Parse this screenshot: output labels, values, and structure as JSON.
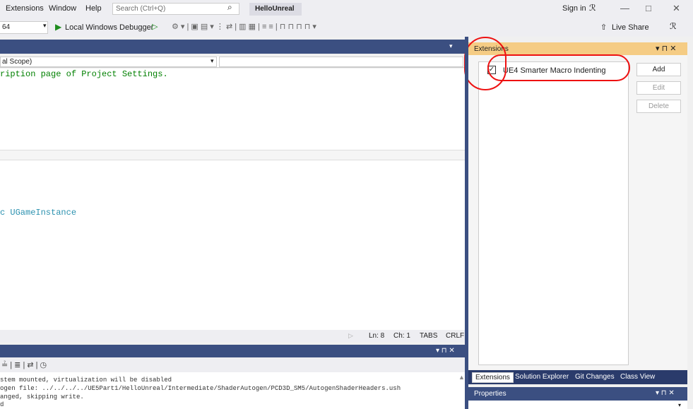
{
  "menubar": {
    "items": [
      "Extensions",
      "Window",
      "Help"
    ],
    "search_placeholder": "Search (Ctrl+Q)",
    "project_name": "HelloUnreal",
    "sign_in": "Sign in",
    "window_buttons": [
      "—",
      "□",
      "✕"
    ]
  },
  "toolbar": {
    "platform": "64",
    "debugger": "Local Windows Debugger",
    "live_share": "Live Share"
  },
  "editor": {
    "scope": "al Scope)",
    "code_line1": "ription page of Project Settings.",
    "code_line2": "c UGameInstance"
  },
  "status": {
    "line": "Ln: 8",
    "col": "Ch: 1",
    "tabs": "TABS",
    "eol": "CRLF"
  },
  "output": {
    "lines": [
      "stem mounted, virtualization will be disabled",
      "ogen file: ../../../../UE5Part1/HelloUnreal/Intermediate/ShaderAutogen/PCD3D_SM5/AutogenShaderHeaders.ush",
      "anged, skipping write.",
      "d"
    ]
  },
  "extensions_panel": {
    "title": "Extensions",
    "header_buttons": "▾ ⊓ ✕",
    "items": [
      {
        "label": "UE4 Smarter Macro Indenting",
        "checked": "✓"
      }
    ],
    "buttons": {
      "add": "Add",
      "edit": "Edit",
      "delete": "Delete"
    }
  },
  "bottom_tabs": [
    "Extensions",
    "Solution Explorer",
    "Git Changes",
    "Class View"
  ],
  "properties": {
    "title": "Properties"
  },
  "colors": {
    "accent_header": "#3b4f81",
    "active_panel_header": "#f5cc84",
    "annotation_red": "#e11111"
  }
}
